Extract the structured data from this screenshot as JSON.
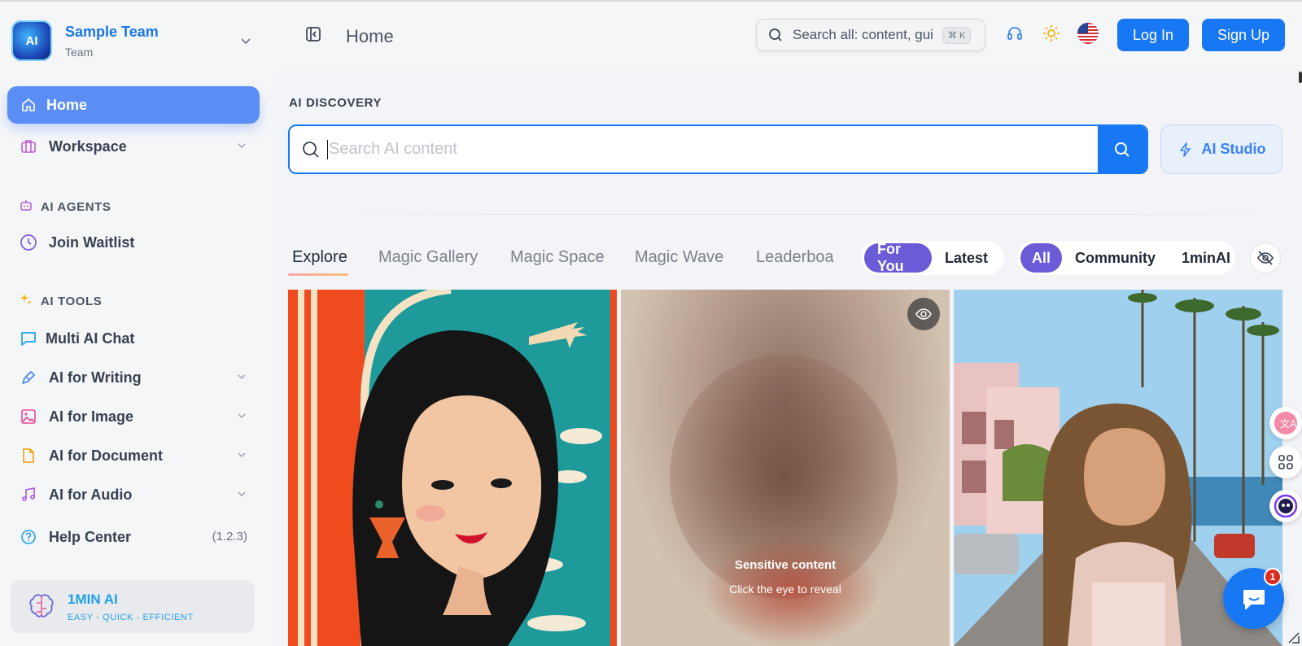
{
  "header": {
    "page_title": "Home",
    "search_placeholder": "Search all: content, gui",
    "shortcut": "⌘ K",
    "login_label": "Log In",
    "signup_label": "Sign Up"
  },
  "sidebar": {
    "team_name": "Sample Team",
    "team_sub": "Team",
    "team_logo_text": "AI",
    "home_label": "Home",
    "workspace_label": "Workspace",
    "agents_section": "AI AGENTS",
    "join_waitlist": "Join Waitlist",
    "tools_section": "AI TOOLS",
    "tools": [
      "Multi AI Chat",
      "AI for Writing",
      "AI for Image",
      "AI for Document",
      "AI for Audio"
    ],
    "help_center": "Help Center",
    "version": "(1.2.3)",
    "brand_title": "1MIN AI",
    "brand_sub": "EASY - QUICK - EFFICIENT"
  },
  "main": {
    "discovery_label": "AI DISCOVERY",
    "search_placeholder": "Search AI content",
    "ai_studio_label": "AI Studio",
    "tabs": [
      "Explore",
      "Magic Gallery",
      "Magic Space",
      "Magic Wave",
      "Leaderboa"
    ],
    "active_tab": "Explore",
    "feed_toggle": [
      "For You",
      "Latest"
    ],
    "source_toggle": [
      "All",
      "Community",
      "1minAI"
    ],
    "sensitive_title": "Sensitive content",
    "sensitive_sub": "Click the eye to reveal"
  },
  "chat": {
    "badge_count": "1"
  },
  "colors": {
    "primary": "#1877f2",
    "home_active": "#5b8ef5",
    "toggle_active": "#6b5bd6"
  }
}
